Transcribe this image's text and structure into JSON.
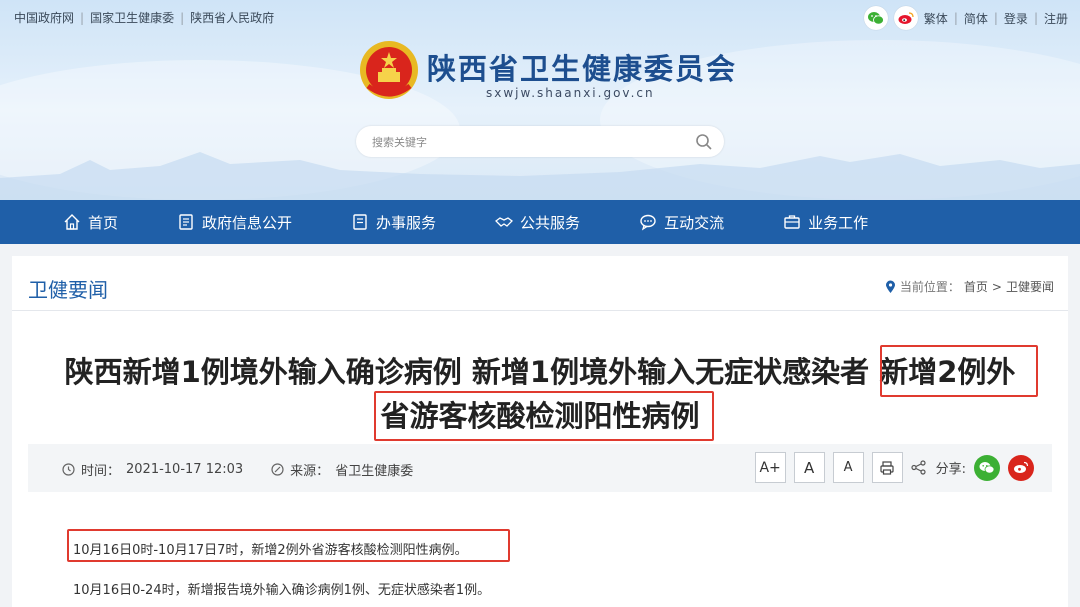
{
  "top_links": [
    "中国政府网",
    "国家卫生健康委",
    "陕西省人民政府"
  ],
  "top_right": {
    "traditional": "繁体",
    "simplified": "简体",
    "login": "登录",
    "register": "注册"
  },
  "site": {
    "title": "陕西省卫生健康委员会",
    "domain": "sxwjw.shaanxi.gov.cn"
  },
  "search": {
    "placeholder": "搜索关键字"
  },
  "nav": [
    {
      "label": "首页",
      "icon": "home-icon"
    },
    {
      "label": "政府信息公开",
      "icon": "document-icon"
    },
    {
      "label": "办事服务",
      "icon": "clipboard-icon"
    },
    {
      "label": "公共服务",
      "icon": "handshake-icon"
    },
    {
      "label": "互动交流",
      "icon": "chat-icon"
    },
    {
      "label": "业务工作",
      "icon": "briefcase-icon"
    }
  ],
  "section": {
    "title": "卫健要闻"
  },
  "breadcrumb": {
    "label": "当前位置：",
    "home": "首页",
    "sep": ">",
    "current": "卫健要闻"
  },
  "article": {
    "title_part1": "陕西新增1例境外输入确诊病例 新增1例境外输入无症状感染者 ",
    "title_part2": "新增2例外",
    "title_part3": "省游客核酸检测阳性病例",
    "time_label": "时间：",
    "time": "2021-10-17 12:03",
    "source_label": "来源：",
    "source": "省卫生健康委",
    "font_large": "A+",
    "font_medium": "A",
    "font_small": "A",
    "share_label": "分享:",
    "para1": "10月16日0时-10月17日7时，新增2例外省游客核酸检测阳性病例。",
    "para2": "10月16日0-24时，新增报告境外输入确诊病例1例、无症状感染者1例。"
  },
  "colors": {
    "nav_bg": "#1f5fa8",
    "highlight": "#e03a2f",
    "title": "#1d4e8f"
  }
}
